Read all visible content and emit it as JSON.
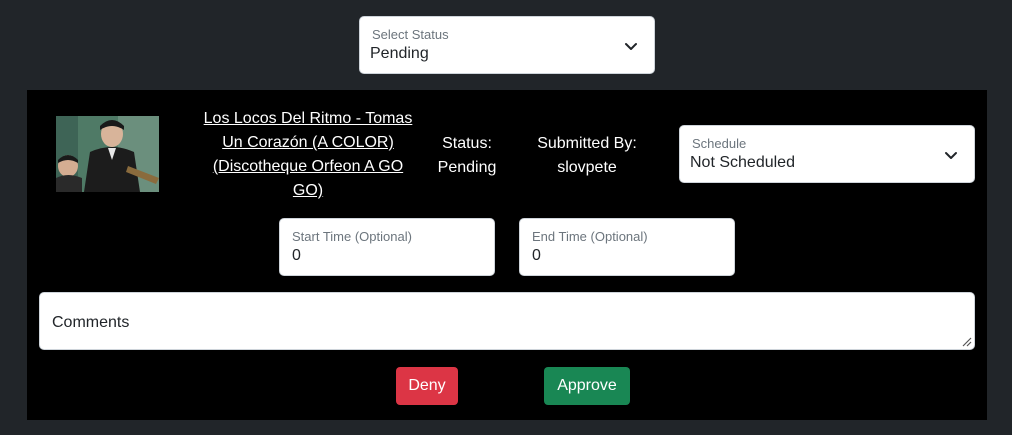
{
  "status_filter": {
    "label": "Select Status",
    "value": "Pending"
  },
  "request": {
    "title": "Los Locos Del Ritmo - Tomas Un Corazón (A COLOR) (Discotheque Orfeon A GO GO)",
    "status_label": "Status:",
    "status_value": "Pending",
    "submitted_label": "Submitted By:",
    "submitted_value": "slovpete",
    "schedule": {
      "label": "Schedule",
      "value": "Not Scheduled"
    },
    "start_time": {
      "label": "Start Time (Optional)",
      "value": "0"
    },
    "end_time": {
      "label": "End Time (Optional)",
      "value": "0"
    },
    "comments_placeholder": "Comments",
    "deny_label": "Deny",
    "approve_label": "Approve"
  },
  "colors": {
    "page_background": "#212529",
    "card_background": "#000000",
    "deny": "#dc3545",
    "approve": "#198754"
  },
  "icons": {
    "dropdown": "chevron-down-icon",
    "resize": "resize-grip-icon"
  }
}
